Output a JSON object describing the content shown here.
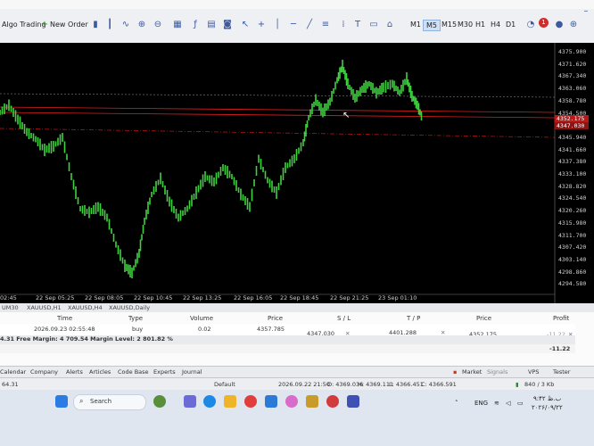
{
  "toolbar": {
    "algo_trading": "Algo Trading",
    "new_order": "New Order",
    "timeframes": [
      "M1",
      "M5",
      "M15",
      "M30",
      "H1",
      "H4",
      "D1"
    ],
    "active_timeframe": "M5",
    "notification_count": "1"
  },
  "chart": {
    "price_levels": [
      "4375.900",
      "4371.620",
      "4367.340",
      "4363.060",
      "4358.780",
      "4354.500",
      "4350.220",
      "4345.940",
      "4341.660",
      "4337.380",
      "4333.100",
      "4328.820",
      "4324.540",
      "4320.260",
      "4315.980",
      "4311.700",
      "4307.420",
      "4303.140",
      "4298.860",
      "4294.580"
    ],
    "bid_badge": "4352.175",
    "sl_badge": "4347.030",
    "time_labels": [
      "02:45",
      "22 Sep 05:25",
      "22 Sep 08:05",
      "22 Sep 10:45",
      "22 Sep 13:25",
      "22 Sep 16:05",
      "22 Sep 18:45",
      "22 Sep 21:25",
      "23 Sep 01:10"
    ],
    "colors": {
      "candles": "#3fd23f",
      "stop_line": "#e01e1e",
      "dashed_line": "#c21a1a"
    }
  },
  "symbol_tabs": [
    "UM30",
    "XAUUSD,H1",
    "XAUUSD,H4",
    "XAUUSD,Daily"
  ],
  "trade": {
    "headers": {
      "time": "Time",
      "type": "Type",
      "volume": "Volume",
      "price": "Price",
      "sl": "S / L",
      "tp": "T / P",
      "current_price": "Price",
      "profit": "Profit"
    },
    "order": {
      "time": "2026.09.23 02:55:48",
      "type": "buy",
      "volume": "0.02",
      "price": "4357.785",
      "sl": "4347.030",
      "tp": "4401.288",
      "current_price": "4352.175",
      "profit": "-11.22"
    },
    "balance_line": "4.31  Free Margin: 4 709.54  Margin Level: 2 801.82 %",
    "total_profit": "-11.22"
  },
  "terminal_tabs": [
    "Calendar",
    "Company",
    "Alerts",
    "Articles",
    "Code Base",
    "Experts",
    "Journal"
  ],
  "terminal_right": {
    "market": "Market",
    "signals": "Signals",
    "vps": "VPS",
    "tester": "Tester"
  },
  "statusbar": {
    "balance_short": "64.31",
    "profile": "Default",
    "datetime": "2026.09.22 21:50",
    "open": "O: 4369.036",
    "high": "H: 4369.111",
    "low": "L: 4366.451",
    "close": "C: 4366.591",
    "traffic": "840 / 3 Kb"
  },
  "taskbar": {
    "search_placeholder": "Search",
    "language": "ENG",
    "time": "۹:۴۲ ب.ظ",
    "date": "۲۰۲۶/۰۹/۲۲"
  }
}
